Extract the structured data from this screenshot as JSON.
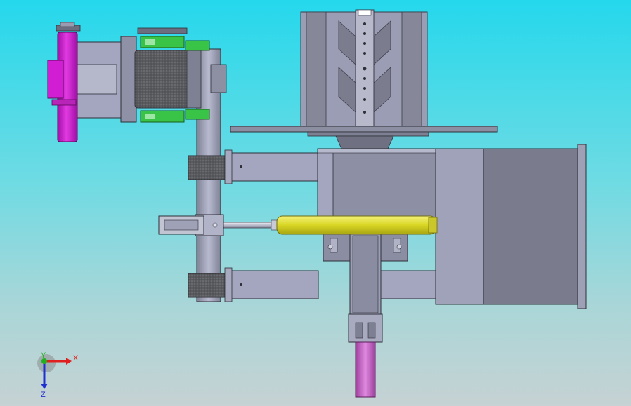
{
  "triad": {
    "x_label": "X",
    "y_label": "Y",
    "z_label": "Z",
    "x_color": "#e02020",
    "y_color": "#20b020",
    "z_color": "#2030d0"
  },
  "colors": {
    "background_top": "#25d8ec",
    "background_bottom": "#c6d2d3",
    "steel_light": "#a4a6c0",
    "steel_dark": "#6f7282",
    "motor": "#d41ed4",
    "cylinder": "#e3e130",
    "bracket": "#39c447",
    "pipe": "#c865c8",
    "roller": "#5b5c60",
    "rubber": "#4f4f4f"
  }
}
